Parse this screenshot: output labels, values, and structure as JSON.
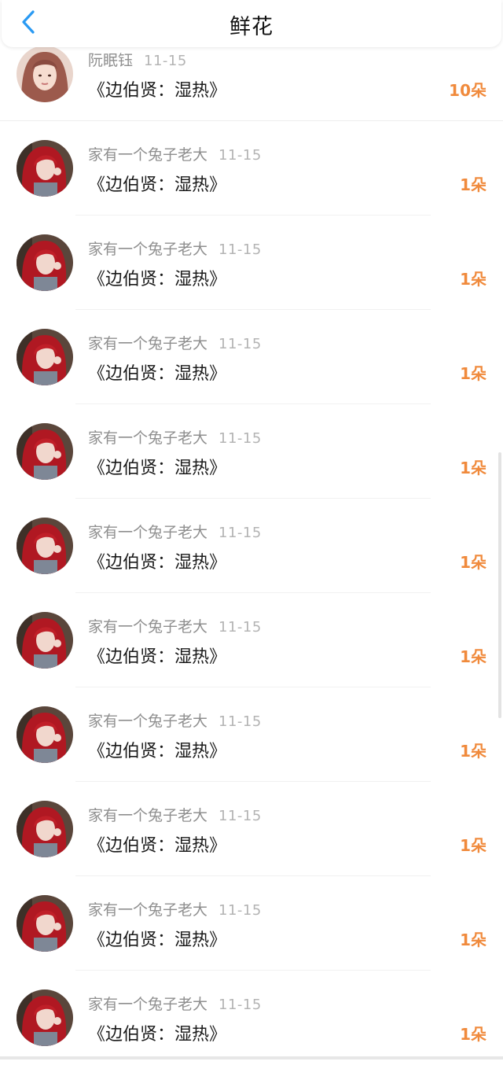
{
  "header": {
    "title": "鲜花",
    "back_icon": "chevron-left-icon",
    "back_color": "#2a9af3"
  },
  "accent_color": "#f08a3c",
  "entries": [
    {
      "name": "阮眠钰",
      "time": "11-15",
      "title": "《边伯贤：湿热》",
      "count": "10朵",
      "avatar": "pink-hair-girl"
    },
    {
      "name": "家有一个兔子老大",
      "time": "11-15",
      "title": "《边伯贤：湿热》",
      "count": "1朵",
      "avatar": "red-hair-girl"
    },
    {
      "name": "家有一个兔子老大",
      "time": "11-15",
      "title": "《边伯贤：湿热》",
      "count": "1朵",
      "avatar": "red-hair-girl"
    },
    {
      "name": "家有一个兔子老大",
      "time": "11-15",
      "title": "《边伯贤：湿热》",
      "count": "1朵",
      "avatar": "red-hair-girl"
    },
    {
      "name": "家有一个兔子老大",
      "time": "11-15",
      "title": "《边伯贤：湿热》",
      "count": "1朵",
      "avatar": "red-hair-girl"
    },
    {
      "name": "家有一个兔子老大",
      "time": "11-15",
      "title": "《边伯贤：湿热》",
      "count": "1朵",
      "avatar": "red-hair-girl"
    },
    {
      "name": "家有一个兔子老大",
      "time": "11-15",
      "title": "《边伯贤：湿热》",
      "count": "1朵",
      "avatar": "red-hair-girl"
    },
    {
      "name": "家有一个兔子老大",
      "time": "11-15",
      "title": "《边伯贤：湿热》",
      "count": "1朵",
      "avatar": "red-hair-girl"
    },
    {
      "name": "家有一个兔子老大",
      "time": "11-15",
      "title": "《边伯贤：湿热》",
      "count": "1朵",
      "avatar": "red-hair-girl"
    },
    {
      "name": "家有一个兔子老大",
      "time": "11-15",
      "title": "《边伯贤：湿热》",
      "count": "1朵",
      "avatar": "red-hair-girl"
    },
    {
      "name": "家有一个兔子老大",
      "time": "11-15",
      "title": "《边伯贤：湿热》",
      "count": "1朵",
      "avatar": "red-hair-girl"
    }
  ]
}
